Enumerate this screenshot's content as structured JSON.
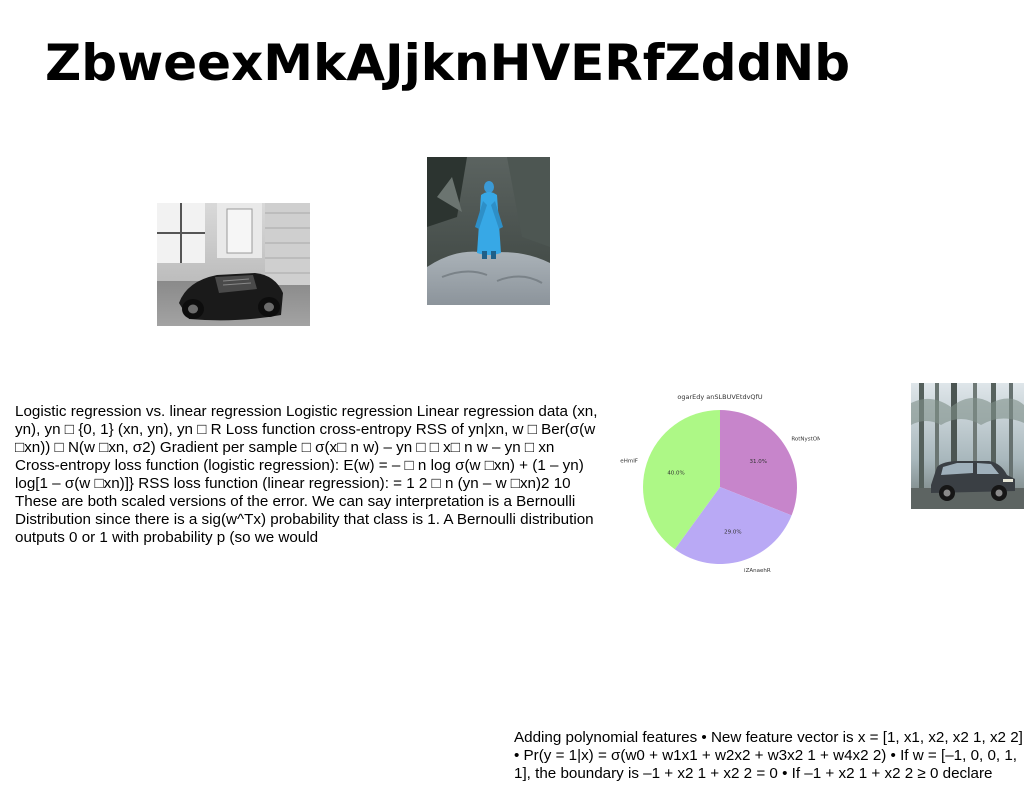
{
  "title": "ZbweexMkAJjknHVERfZddNb",
  "images": [
    {
      "name": "photo-car-bw",
      "icon": "car-photo"
    },
    {
      "name": "photo-figure",
      "icon": "person-photo"
    },
    {
      "name": "photo-suv",
      "icon": "suv-photo"
    }
  ],
  "main_text": "Logistic regression vs. linear regression Logistic regression Linear regression data (xn, yn), yn □ {0, 1} (xn, yn), yn □ R Loss function cross-entropy RSS of yn|xn, w □ Ber(σ(w □xn)) □ N(w □xn, σ2) Gradient per sample □ σ(x□ n w) – yn □ □ x□ n w – yn □ xn Cross-entropy loss function (logistic regression): E(w) = – □ n log σ(w □xn) + (1 – yn) log[1 – σ(w □xn)]} RSS loss function (linear regression): = 1 2 □ n (yn – w □xn)2 10 These are both scaled versions of the error. We can say interpretation is a Bernoulli Distribution since there is a sig(w^Tx) probability that class is 1. A Bernoulli distribution outputs 0 or 1 with probability p (so we would",
  "bottom_text": "Adding polynomial features • New feature vector is x = [1, x1, x2, x2 1, x2 2] • Pr(y = 1|x) = σ(w0 + w1x1 + w2x2 + w3x2 1 + w4x2 2) • If w = [–1, 0, 0, 1, 1], the boundary is –1 + x2 1 + x2 2 = 0 • If –1 + x2 1 + x2 2 ≥ 0 declare",
  "chart_data": {
    "type": "pie",
    "title": "ogarEdy anSLBUVEtdvQfU",
    "slices": [
      {
        "label": "RotNystOMi",
        "value": 31.0,
        "pct_label": "31.0%",
        "color": "#c785cb"
      },
      {
        "label": "iZAnaehR",
        "value": 29.0,
        "pct_label": "29.0%",
        "color": "#b9a9f5"
      },
      {
        "label": "ICZzgeHmIF",
        "value": 40.0,
        "pct_label": "40.0%",
        "color": "#adf886"
      }
    ],
    "start_angle_deg": 90,
    "direction": "clockwise",
    "legend": "none"
  }
}
